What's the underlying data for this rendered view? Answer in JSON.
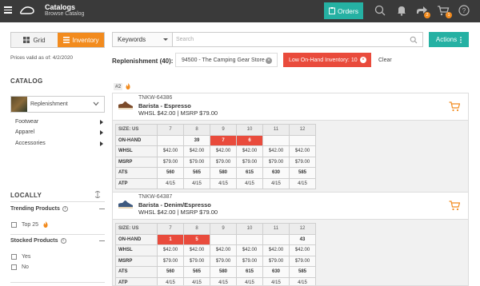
{
  "header": {
    "title": "Catalogs",
    "subtitle": "Browse Catalog",
    "orders_label": "Orders",
    "shipments_badge": "2",
    "cart_badge": "1"
  },
  "sidebar": {
    "view_grid": "Grid",
    "view_inventory": "Inventory",
    "prices_valid": "Prices valid as of: 4/2/2020",
    "catalog_heading": "CATALOG",
    "catalog_selected": "Replenishment",
    "nav": [
      "Footwear",
      "Apparel",
      "Accessories"
    ],
    "locally_heading": "LOCALLY",
    "trending_title": "Trending Products",
    "trending_options": [
      "Top 25"
    ],
    "stocked_title": "Stocked Products",
    "stocked_options": [
      "Yes",
      "No"
    ]
  },
  "toolbar": {
    "keywords_label": "Keywords",
    "search_placeholder": "Search",
    "actions_label": "Actions"
  },
  "filters": {
    "replenishment_label": "Replenishment (40):",
    "store_chip": "94500 - The Camping Gear Store",
    "onhand_chip": "Low On-Hand Inventory: 10",
    "clear_label": "Clear"
  },
  "rank_tag": "#2",
  "products": [
    {
      "sku": "TNKW-64386",
      "name": "Barista - Espresso",
      "price": "WHSL $42.00 | MSRP $79.00",
      "shoe_color": "#7b4a2a",
      "sizes_label": "SIZE: US",
      "sizes": [
        "7",
        "8",
        "9",
        "10",
        "11",
        "12"
      ],
      "rows": [
        {
          "label": "ON-HAND",
          "values": [
            "",
            "39",
            "7",
            "6",
            "",
            ""
          ],
          "red": [
            false,
            false,
            true,
            true,
            false,
            false
          ]
        },
        {
          "label": "WHSL",
          "values": [
            "$42.00",
            "$42.00",
            "$42.00",
            "$42.00",
            "$42.00",
            "$42.00"
          ]
        },
        {
          "label": "MSRP",
          "values": [
            "$79.00",
            "$79.00",
            "$79.00",
            "$79.00",
            "$79.00",
            "$79.00"
          ]
        },
        {
          "label": "ATS",
          "values": [
            "560",
            "565",
            "580",
            "615",
            "630",
            "585"
          ],
          "bold": true
        },
        {
          "label": "ATP",
          "values": [
            "4/15",
            "4/15",
            "4/15",
            "4/15",
            "4/15",
            "4/15"
          ]
        }
      ]
    },
    {
      "sku": "TNKW-64387",
      "name": "Barista - Denim/Espresso",
      "price": "WHSL $42.00 | MSRP $79.00",
      "shoe_color": "#3f5a80",
      "sizes_label": "SIZE: US",
      "sizes": [
        "7",
        "8",
        "9",
        "10",
        "11",
        "12"
      ],
      "rows": [
        {
          "label": "ON-HAND",
          "values": [
            "1",
            "5",
            "",
            "",
            "",
            "43"
          ],
          "red": [
            true,
            true,
            false,
            false,
            false,
            false
          ]
        },
        {
          "label": "WHSL",
          "values": [
            "$42.00",
            "$42.00",
            "$42.00",
            "$42.00",
            "$42.00",
            "$42.00"
          ]
        },
        {
          "label": "MSRP",
          "values": [
            "$79.00",
            "$79.00",
            "$79.00",
            "$79.00",
            "$79.00",
            "$79.00"
          ]
        },
        {
          "label": "ATS",
          "values": [
            "560",
            "565",
            "580",
            "615",
            "630",
            "585"
          ],
          "bold": true
        },
        {
          "label": "ATP",
          "values": [
            "4/15",
            "4/15",
            "4/15",
            "4/15",
            "4/15",
            "4/15"
          ]
        }
      ]
    }
  ]
}
